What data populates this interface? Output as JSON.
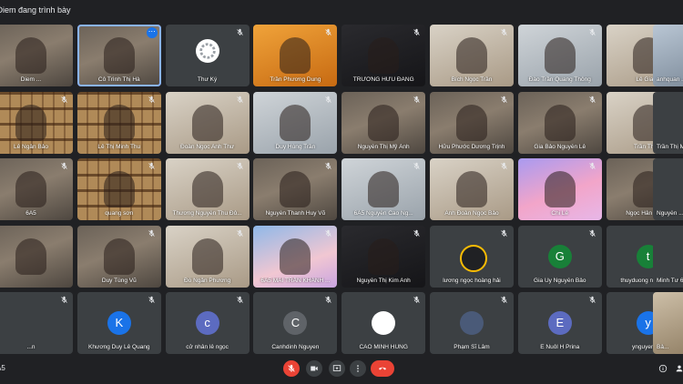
{
  "presenting_text": "i Diem đang trình bày",
  "meeting_code": "A5",
  "tiles": [
    {
      "label": "Diem ...",
      "kind": "video",
      "mic": ""
    },
    {
      "label": "Cô Trình Thị Hà",
      "kind": "video",
      "mic": "",
      "selected": true,
      "more": "⋯"
    },
    {
      "label": "Thư Ký",
      "kind": "spinner",
      "mic": "muted"
    },
    {
      "label": "Trần Phương Dung",
      "kind": "orange",
      "mic": "muted"
    },
    {
      "label": "TRƯƠNG HỮU ĐĂNG",
      "kind": "dark",
      "mic": "muted"
    },
    {
      "label": "Bích Ngọc Trần",
      "kind": "room",
      "mic": "muted"
    },
    {
      "label": "Đào Trần Quang Thông",
      "kind": "bright",
      "mic": "muted"
    },
    {
      "label": "Lê Giang",
      "kind": "room",
      "mic": "muted"
    },
    {
      "label": "Lê Ngân Bảo",
      "kind": "bookshelf",
      "mic": "muted"
    },
    {
      "label": "Lê Thị Minh Thu",
      "kind": "bookshelf",
      "mic": "muted"
    },
    {
      "label": "Đoàn Ngọc Anh Thư",
      "kind": "room",
      "mic": "muted"
    },
    {
      "label": "Duy Hùng Trần",
      "kind": "bright",
      "mic": "muted"
    },
    {
      "label": "Nguyễn Thị Mỹ Ánh",
      "kind": "video",
      "mic": "muted"
    },
    {
      "label": "Hữu Phước Dương Trịnh",
      "kind": "video",
      "mic": "muted"
    },
    {
      "label": "Gia Bảo Nguyễn Lê",
      "kind": "video",
      "mic": "muted"
    },
    {
      "label": "Trần Thị ...",
      "kind": "room",
      "mic": "muted"
    },
    {
      "label": "6A5",
      "kind": "video",
      "mic": "muted"
    },
    {
      "label": "quang sơn",
      "kind": "bookshelf",
      "mic": "muted"
    },
    {
      "label": "Thương Nguyễn Thu Đô...",
      "kind": "room",
      "mic": "muted"
    },
    {
      "label": "Nguyễn Thanh Huy Võ",
      "kind": "video",
      "mic": "muted"
    },
    {
      "label": "6A5 Nguyễn Cao Ng...",
      "kind": "bright",
      "mic": "muted"
    },
    {
      "label": "Anh Đoàn Ngọc Bảo",
      "kind": "room",
      "mic": "muted"
    },
    {
      "label": "Chi Lê",
      "kind": "pink",
      "mic": "muted"
    },
    {
      "label": "Ngọc Hân Lê Thị",
      "kind": "video",
      "mic": "muted"
    },
    {
      "label": "",
      "kind": "video",
      "mic": ""
    },
    {
      "label": "Duy Tùng Vũ",
      "kind": "video",
      "mic": "muted"
    },
    {
      "label": "Đỗ Ngân Phương",
      "kind": "room",
      "mic": "muted"
    },
    {
      "label": "6A5 MAI TRẦN KHÁNH ...",
      "kind": "anime",
      "mic": "muted"
    },
    {
      "label": "Nguyễn Thị Kim Anh",
      "kind": "dark",
      "mic": "muted"
    },
    {
      "label": "lương ngọc hoàng hải",
      "kind": "avatar",
      "initial": "",
      "color": "#202124",
      "ring": true,
      "mic": "muted"
    },
    {
      "label": "Gia Uy Nguyễn Bảo",
      "kind": "avatar",
      "initial": "G",
      "color": "#188038",
      "mic": "muted"
    },
    {
      "label": "thuyduong nguyenthi",
      "kind": "avatar",
      "initial": "t",
      "color": "#188038",
      "mic": "muted"
    },
    {
      "label": "...n",
      "kind": "plain",
      "mic": "muted"
    },
    {
      "label": "Khương Duy Lê Quang",
      "kind": "avatar",
      "initial": "K",
      "color": "#1a73e8",
      "mic": "muted"
    },
    {
      "label": "cử nhân lê ngọc",
      "kind": "avatar",
      "initial": "c",
      "color": "#5c6bc0",
      "mic": "muted"
    },
    {
      "label": "Canhdinh Nguyen",
      "kind": "avatar",
      "initial": "C",
      "color": "#5f6368",
      "mic": "muted"
    },
    {
      "label": "CAO MINH HÙNG",
      "kind": "avatar",
      "initial": "",
      "color": "#ffffff",
      "mic": "muted"
    },
    {
      "label": "Phạm Sĩ Lâm",
      "kind": "avatar",
      "initial": "",
      "color": "#4a5a78",
      "mic": "muted"
    },
    {
      "label": "E Nuôl H Prina",
      "kind": "avatar",
      "initial": "E",
      "color": "#5c6bc0",
      "mic": "muted"
    },
    {
      "label": "ynguyen nie",
      "kind": "avatar",
      "initial": "y",
      "color": "#1a73e8",
      "mic": "muted"
    }
  ],
  "right_partial": [
    {
      "label": "anhquan ..."
    },
    {
      "label": "Trần Thị M..."
    },
    {
      "label": "Nguyễn ..."
    },
    {
      "label": "Minh Tư 6..."
    },
    {
      "label": "Bả..."
    }
  ],
  "controls": {
    "mic": "mic-off-icon",
    "camera": "camera-icon",
    "present": "present-icon",
    "more": "more-icon",
    "hangup": "hang-up-icon"
  },
  "colors": {
    "background": "#202124",
    "tile": "#3c4043",
    "red": "#ea4335",
    "selected": "#8ab4f8"
  }
}
